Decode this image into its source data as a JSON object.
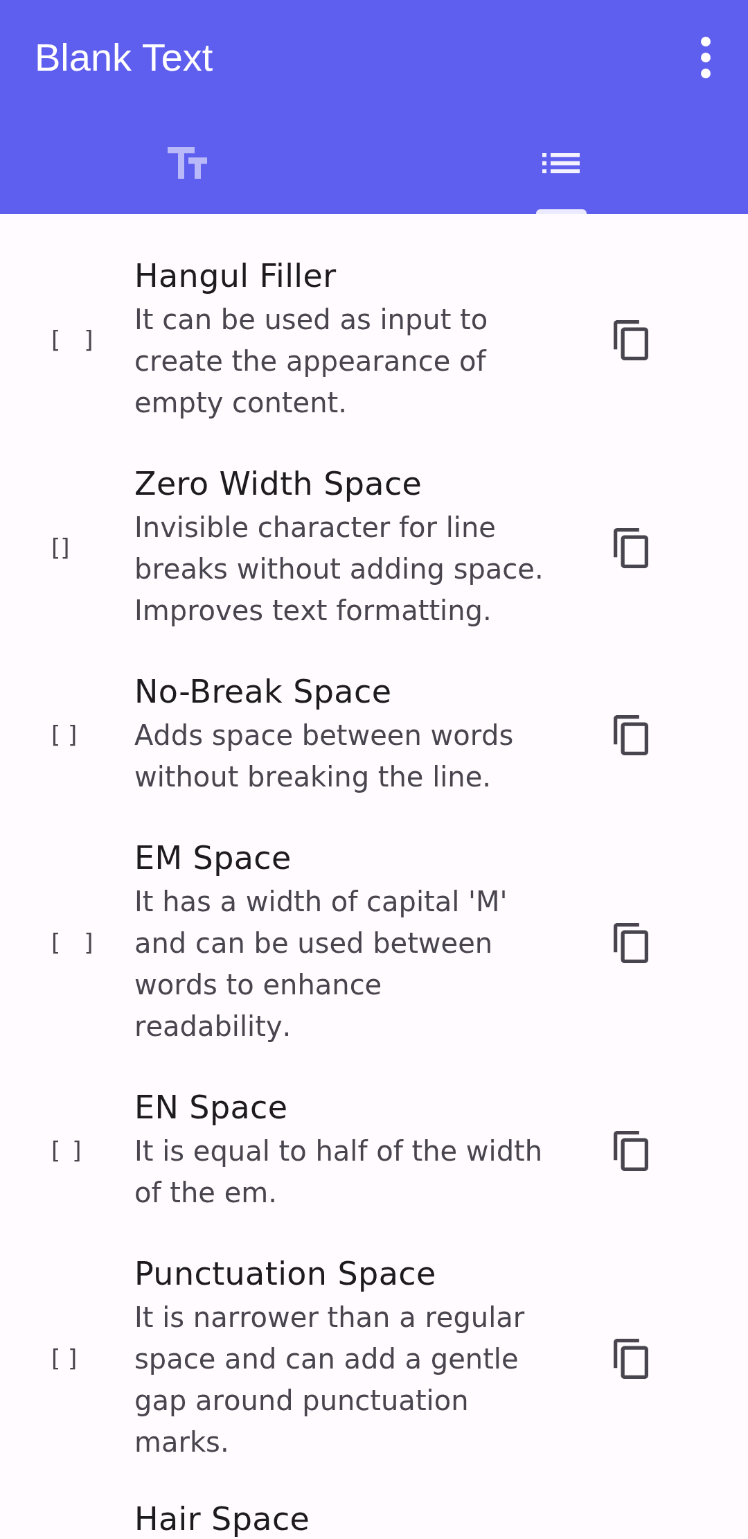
{
  "app_bar": {
    "title": "Blank Text"
  },
  "tabs": [
    {
      "kind": "text_size",
      "selected": false
    },
    {
      "kind": "list",
      "selected": true
    }
  ],
  "items": [
    {
      "preview": "[ ]",
      "title": "Hangul Filler",
      "description": "It can be used as input to create the appearance of empty content."
    },
    {
      "preview": "[​]",
      "title": "Zero Width Space",
      "description": "Invisible character for line breaks without adding space. Improves text formatting."
    },
    {
      "preview": "[ ]",
      "title": "No-Break Space",
      "description": "Adds space between words without breaking the line."
    },
    {
      "preview": "[ ]",
      "title": "EM Space",
      "description": "It has a width of capital 'M' and can be used between words to enhance readability."
    },
    {
      "preview": "[ ]",
      "title": "EN Space",
      "description": "It is equal to half of the width of the em."
    },
    {
      "preview": "[ ]",
      "title": "Punctuation Space",
      "description": "It is narrower than a regular space and can add a gentle gap around punctuation marks."
    }
  ],
  "partly_hidden_item": {
    "title": "Hair Space"
  }
}
